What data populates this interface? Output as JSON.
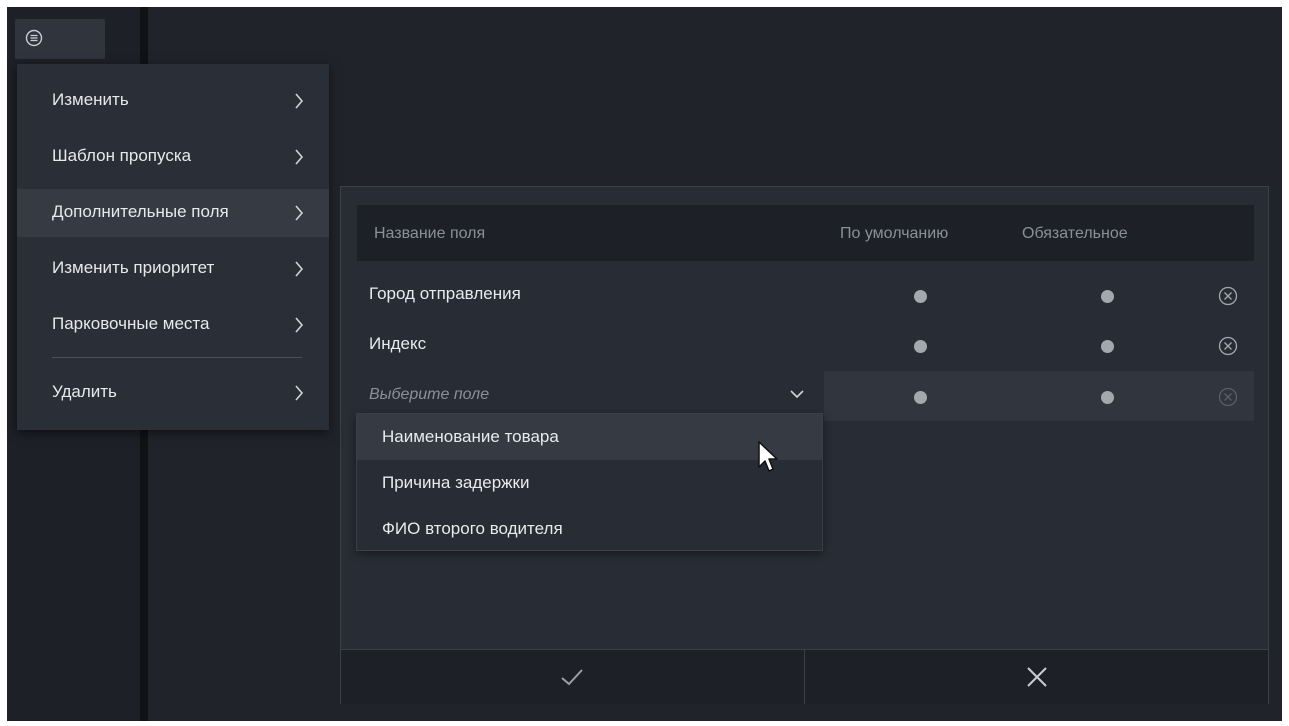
{
  "app": {
    "menu_button_icon": "list-circle-icon"
  },
  "context_menu": {
    "items": [
      {
        "label": "Изменить",
        "icon": "chevron-right-icon"
      },
      {
        "label": "Шаблон пропуска",
        "icon": "chevron-right-icon"
      },
      {
        "label": "Дополнительные поля",
        "icon": "chevron-right-icon",
        "active": true
      },
      {
        "label": "Изменить приоритет",
        "icon": "chevron-right-icon"
      },
      {
        "label": "Парковочные места",
        "icon": "chevron-right-icon"
      },
      {
        "label": "Удалить",
        "icon": "chevron-right-icon"
      }
    ]
  },
  "fields_panel": {
    "columns": {
      "name": "Название поля",
      "default": "По умолчанию",
      "required": "Обязательное"
    },
    "rows": [
      {
        "name": "Город отправления",
        "default": false,
        "required": false,
        "remove_icon": "circle-x-icon"
      },
      {
        "name": "Индекс",
        "default": false,
        "required": false,
        "remove_icon": "circle-x-icon"
      }
    ],
    "new_row": {
      "placeholder": "Выберите поле",
      "default": false,
      "required": false
    },
    "dropdown": {
      "options": [
        "Наименование товара",
        "Причина задержки",
        "ФИО второго водителя"
      ],
      "hovered_index": 0
    },
    "footer": {
      "confirm_icon": "check-icon",
      "cancel_icon": "x-icon"
    }
  },
  "colors": {
    "background": "#20232a",
    "panel": "#282c34",
    "header": "#1d2026",
    "text": "#e8eaee",
    "muted_text": "#8a909a",
    "dot": "#a3a7ae"
  }
}
